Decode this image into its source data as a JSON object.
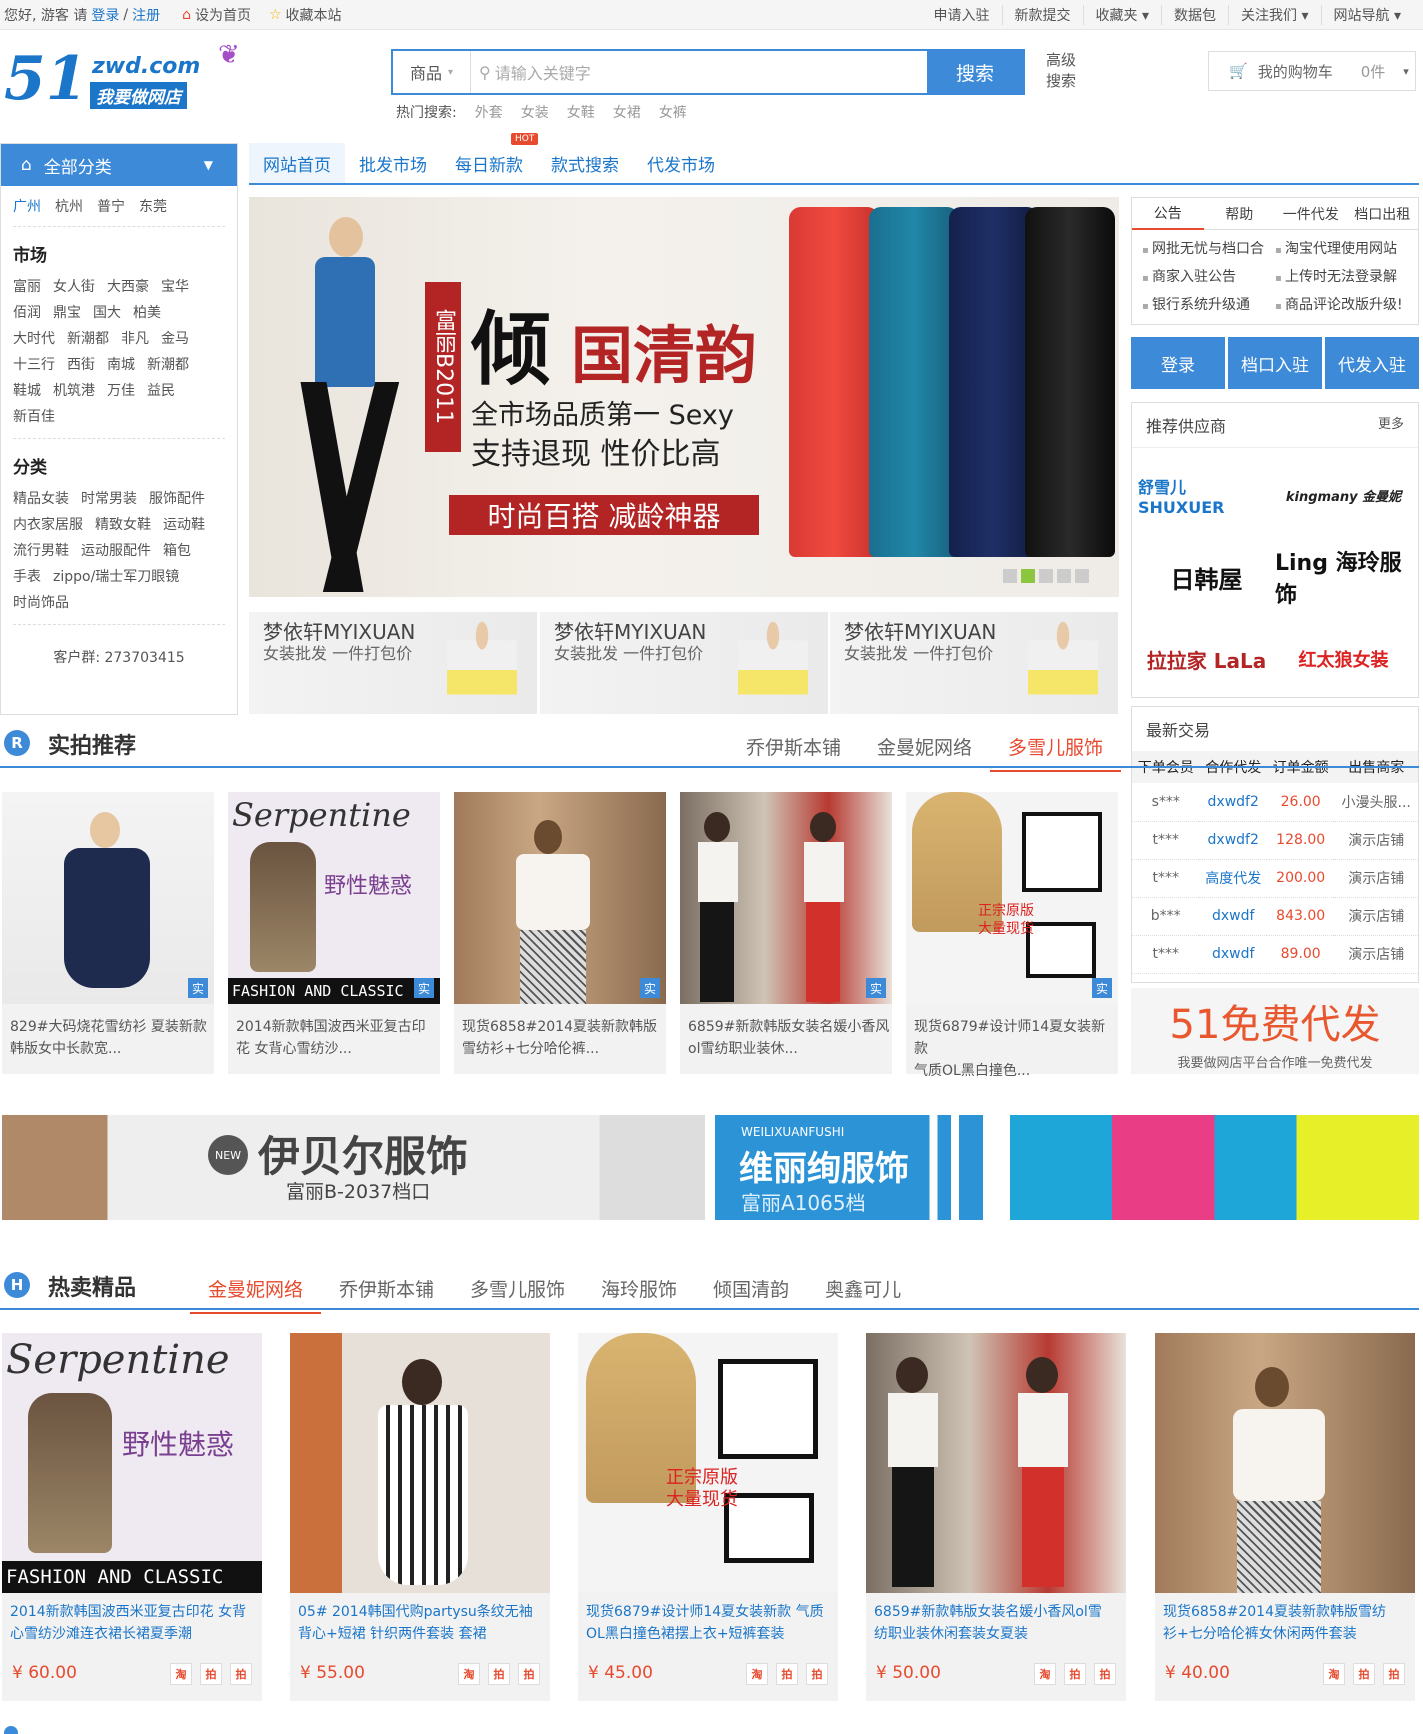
{
  "topbar": {
    "greeting": "您好, 游客 请",
    "login": "登录",
    "sep": "/",
    "register": "注册",
    "set_home": "设为首页",
    "bookmark": "收藏本站",
    "right_items": [
      "申请入驻",
      "新款提交",
      "收藏夹 ▾",
      "数据包",
      "关注我们 ▾",
      "网站导航 ▾"
    ]
  },
  "logo": {
    "num": "51",
    "domain": "zwd.com",
    "slogan": "我要做网店"
  },
  "search": {
    "category": "商品",
    "placeholder": "请输入关键字",
    "button": "搜索",
    "advanced_1": "高级",
    "advanced_2": "搜索",
    "hot_label": "热门搜索:",
    "hot_words": [
      "外套",
      "女装",
      "女鞋",
      "女裙",
      "女裤"
    ]
  },
  "cart": {
    "label": "我的购物车",
    "count": "0件"
  },
  "sidebar": {
    "title": "全部分类",
    "cities": [
      "广州",
      "杭州",
      "普宁",
      "东莞"
    ],
    "market_title": "市场",
    "markets": [
      [
        "富丽",
        "女人街",
        "大西豪",
        "宝华"
      ],
      [
        "佰润",
        "鼎宝",
        "国大",
        "柏美"
      ],
      [
        "大时代",
        "新潮都",
        "非凡",
        "金马"
      ],
      [
        "十三行",
        "西街",
        "南城",
        "新潮都"
      ],
      [
        "鞋城",
        "机筑港",
        "万佳",
        "益民"
      ],
      [
        "新百佳"
      ]
    ],
    "cat_title": "分类",
    "cats": [
      [
        "精品女装",
        "时常男装",
        "服饰配件"
      ],
      [
        "内衣家居服",
        "精致女鞋",
        "运动鞋"
      ],
      [
        "流行男鞋",
        "运动服配件",
        "箱包"
      ],
      [
        "手表",
        "zippo/瑞士军刀眼镜"
      ],
      [
        "时尚饰品"
      ]
    ],
    "qq": "客户群: 273703415"
  },
  "nav": {
    "tabs": [
      "网站首页",
      "批发市场",
      "每日新款",
      "款式搜索",
      "代发市场"
    ],
    "hot_badge": "HOT"
  },
  "banner": {
    "side": "富丽B2011",
    "big_a": "倾",
    "big_b": "国清韵",
    "line1": "全市场品质第一 Sexy",
    "line2": "支持退现 性价比高",
    "strip": "时尚百搭 减龄神器"
  },
  "subbanners": [
    {
      "t1": "梦依轩MYIXUAN",
      "t2": "女装批发 一件打包价"
    },
    {
      "t1": "梦依轩MYIXUAN",
      "t2": "女装批发 一件打包价"
    },
    {
      "t1": "梦依轩MYIXUAN",
      "t2": "女装批发 一件打包价"
    }
  ],
  "notice": {
    "tabs": [
      "公告",
      "帮助",
      "一件代发",
      "档口出租"
    ],
    "items": [
      "网批无忧与档口合",
      "淘宝代理使用网站",
      "商家入驻公告",
      "上传时无法登录解",
      "银行系统升级通",
      "商品评论改版升级!"
    ]
  },
  "action_buttons": [
    "登录",
    "档口入驻",
    "代发入驻"
  ],
  "suppliers": {
    "title": "推荐供应商",
    "more": "更多",
    "logos": [
      "舒雪儿 SHUXUER",
      "kingmany 金曼妮",
      "日韩屋",
      "Ling 海玲服饰",
      "拉拉家 LaLa",
      "红太狼女装"
    ]
  },
  "trades": {
    "title": "最新交易",
    "headers": [
      "下单会员",
      "合作代发",
      "订单金额",
      "出售商家"
    ],
    "rows": [
      [
        "s***",
        "dxwdf2",
        "26.00",
        "小漫头服..."
      ],
      [
        "t***",
        "dxwdf2",
        "128.00",
        "演示店铺"
      ],
      [
        "t***",
        "高度代发",
        "200.00",
        "演示店铺"
      ],
      [
        "b***",
        "dxwdf",
        "843.00",
        "演示店铺"
      ],
      [
        "t***",
        "dxwdf",
        "89.00",
        "演示店铺"
      ]
    ]
  },
  "free": {
    "big": "51免费代发",
    "small": "我要做网店平台合作唯一免费代发"
  },
  "real_section": {
    "badge": "R",
    "title": "实拍推荐",
    "tabs": [
      "乔伊斯本铺",
      "金曼妮网络",
      "多雪儿服饰"
    ],
    "real_tag": "实",
    "products": [
      {
        "line1": "829#大码烧花雪纺衫 夏装新款",
        "line2": "韩版女中长款宽..."
      },
      {
        "line1": "2014新款韩国波西米亚复古印",
        "line2": "花 女背心雪纺沙..."
      },
      {
        "line1": "现货6858#2014夏装新款韩版",
        "line2": "雪纺衫+七分哈伦裤..."
      },
      {
        "line1": "6859#新款韩版女装名媛小香风",
        "line2": "ol雪纺职业装休..."
      },
      {
        "line1": "现货6879#设计师14夏女装新款",
        "line2": "气质OL黑白撞色..."
      }
    ],
    "img_texts": {
      "serpentine": "Serpentine",
      "wild": "野性魅惑",
      "fashion": "FASHION AND CLASSIC",
      "genuine1": "正宗原版",
      "genuine2": "大量现货"
    }
  },
  "ad_banners": {
    "a_title": "伊贝尔服饰",
    "a_sub": "富丽B-2037档口",
    "a_new": "NEW",
    "b_top": "WEILIXUANFUSHI",
    "b_title": "维丽绚服饰",
    "b_sub": "富丽A1065档"
  },
  "hot_section": {
    "badge": "H",
    "title": "热卖精品",
    "tabs": [
      "金曼妮网络",
      "乔伊斯本铺",
      "多雪儿服饰",
      "海玲服饰",
      "倾国清韵",
      "奥鑫可儿"
    ],
    "shop_icons": [
      "淘",
      "拍",
      "拍"
    ],
    "products": [
      {
        "line1": "2014新款韩国波西米亚复古印花 女背",
        "line2": "心雪纺沙滩连衣裙长裙夏季潮",
        "price": "¥ 60.00"
      },
      {
        "line1": "05# 2014韩国代购partysu条纹无袖",
        "line2": "背心+短裙 针织两件套装 套裙",
        "price": "¥ 55.00"
      },
      {
        "line1": "现货6879#设计师14夏女装新款 气质",
        "line2": "OL黑白撞色裙摆上衣+短裤套装",
        "price": "¥ 45.00"
      },
      {
        "line1": "6859#新款韩版女装名媛小香风ol雪",
        "line2": "纺职业装休闲套装女夏装",
        "price": "¥ 50.00"
      },
      {
        "line1": "现货6858#2014夏装新款韩版雪纺",
        "line2": "衫+七分哈伦裤女休闲两件套装",
        "price": "¥ 40.00"
      }
    ]
  }
}
